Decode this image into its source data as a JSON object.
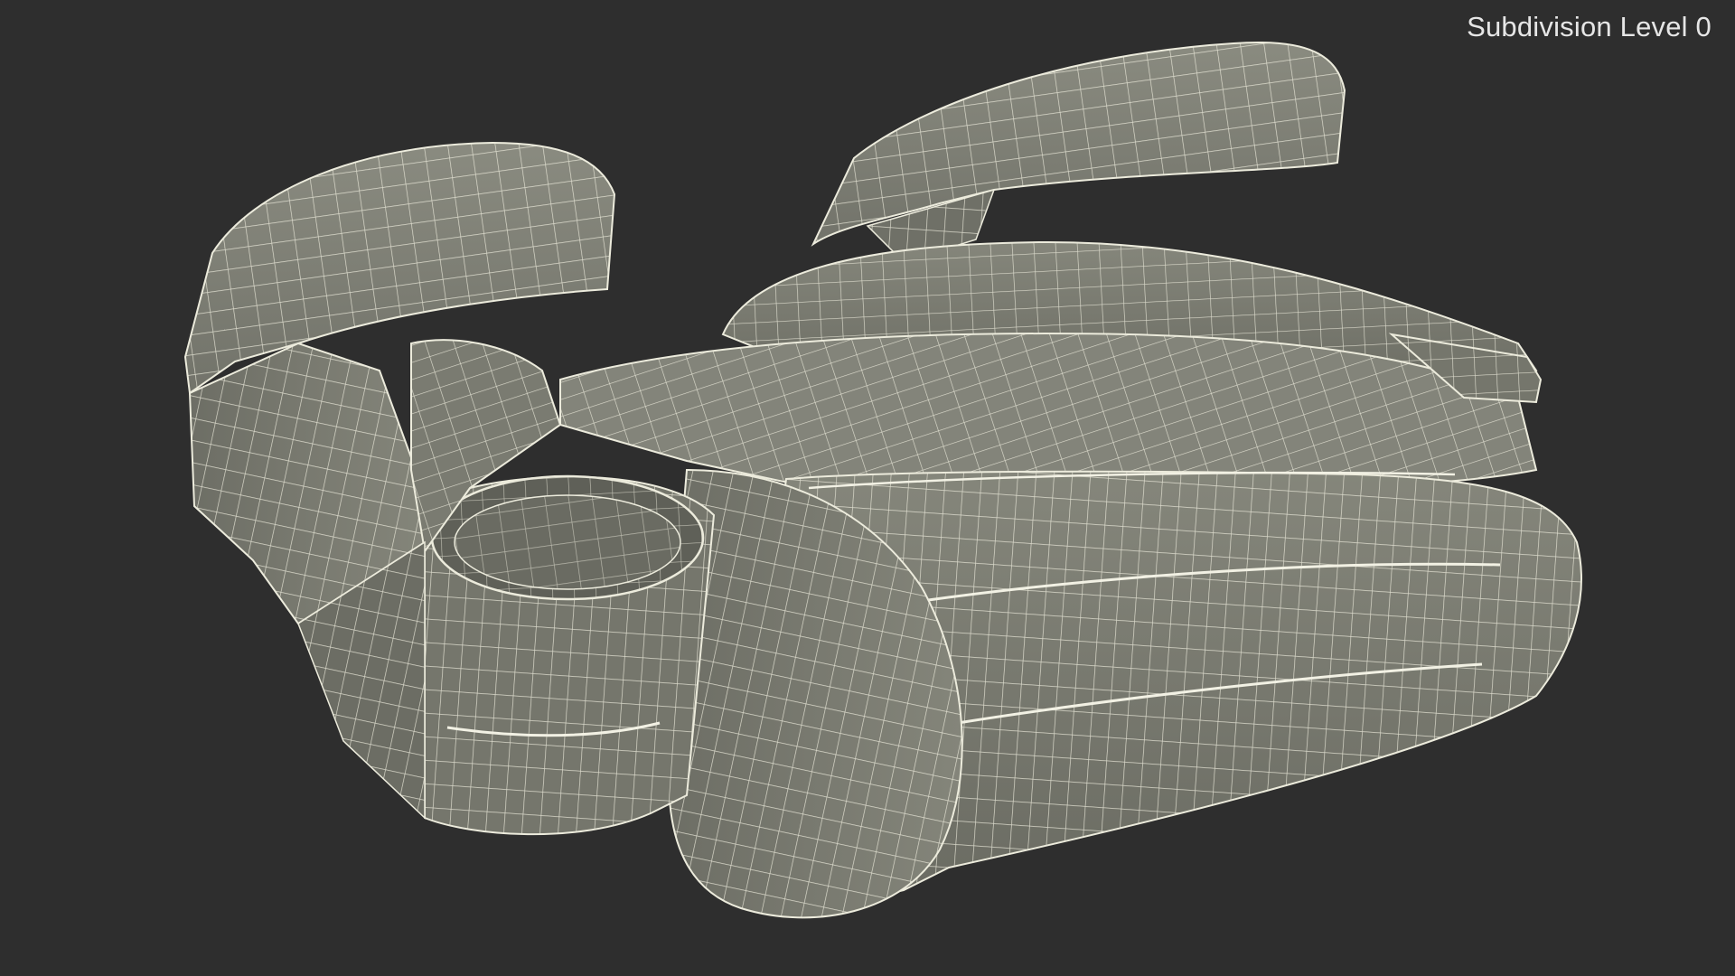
{
  "viewport": {
    "label": "Subdivision Level 0"
  },
  "colors": {
    "background": "#2e2e2e",
    "surface": "#7e7f74",
    "surface_shadow": "#64655c",
    "surface_light": "#8c8d82",
    "wire": "#ecebdc"
  },
  "icons": []
}
